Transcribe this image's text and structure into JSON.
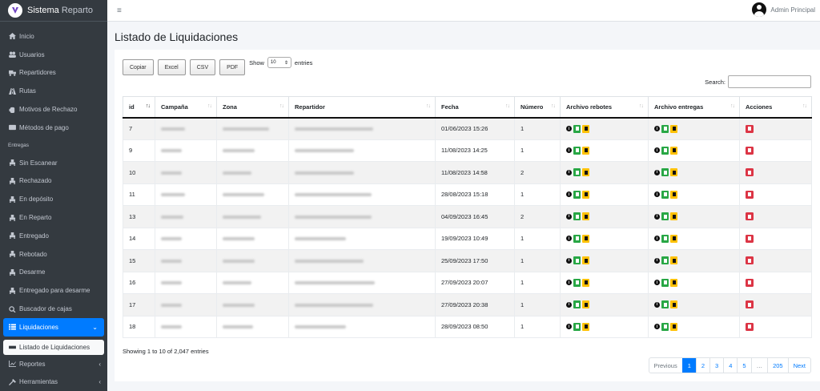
{
  "brand": {
    "name_bold": "Sistema",
    "name_rest": "Reparto"
  },
  "topbar": {
    "menu_icon": "≡",
    "user_name": "Admin Principal"
  },
  "sidebar": {
    "items": [
      {
        "label": "Inicio",
        "icon": "home-icon"
      },
      {
        "label": "Usuarios",
        "icon": "users-icon"
      },
      {
        "label": "Repartidores",
        "icon": "truck-icon"
      },
      {
        "label": "Rutas",
        "icon": "route-icon"
      },
      {
        "label": "Motivos de Rechazo",
        "icon": "hand-icon"
      },
      {
        "label": "Métodos de pago",
        "icon": "card-icon"
      }
    ],
    "header": "Entregas",
    "entregas": [
      {
        "label": "Sin Escanear"
      },
      {
        "label": "Rechazado"
      },
      {
        "label": "En depósito"
      },
      {
        "label": "En Reparto"
      },
      {
        "label": "Entregado"
      },
      {
        "label": "Rebotado"
      },
      {
        "label": "Desarme"
      },
      {
        "label": "Entregado para desarme"
      }
    ],
    "buscador": "Buscador de cajas",
    "liquidaciones": "Liquidaciones",
    "listado": "Listado de Liquidaciones",
    "reportes": "Reportes",
    "herramientas": "Herramientas"
  },
  "page": {
    "title": "Listado de Liquidaciones"
  },
  "toolbar": {
    "copy": "Copiar",
    "excel": "Excel",
    "csv": "CSV",
    "pdf": "PDF",
    "show": "Show",
    "show_value": "10",
    "entries": "entries",
    "search_label": "Search:"
  },
  "table": {
    "headers": [
      "id",
      "Campaña",
      "Zona",
      "Repartidor",
      "Fecha",
      "Número",
      "Archivo rebotes",
      "Archivo entregas",
      "Acciones"
    ],
    "rows": [
      {
        "id": "7",
        "fecha": "01/06/2023 15:26",
        "numero": "1"
      },
      {
        "id": "9",
        "fecha": "11/08/2023 14:25",
        "numero": "1"
      },
      {
        "id": "10",
        "fecha": "11/08/2023 14:58",
        "numero": "2"
      },
      {
        "id": "11",
        "fecha": "28/08/2023 15:18",
        "numero": "1"
      },
      {
        "id": "13",
        "fecha": "04/09/2023 16:45",
        "numero": "2"
      },
      {
        "id": "14",
        "fecha": "19/09/2023 10:49",
        "numero": "1"
      },
      {
        "id": "15",
        "fecha": "25/09/2023 17:50",
        "numero": "1"
      },
      {
        "id": "16",
        "fecha": "27/09/2023 20:07",
        "numero": "1"
      },
      {
        "id": "17",
        "fecha": "27/09/2023 20:38",
        "numero": "1"
      },
      {
        "id": "18",
        "fecha": "28/09/2023 08:50",
        "numero": "1"
      }
    ]
  },
  "footer": {
    "info": "Showing 1 to 10 of 2,047 entries",
    "pager": [
      "Previous",
      "1",
      "2",
      "3",
      "4",
      "5",
      "…",
      "205",
      "Next"
    ]
  },
  "colors": {
    "accent": "#007bff",
    "sidebar": "#343a40",
    "success": "#28a745",
    "warning": "#ffc107",
    "danger": "#dc3545"
  }
}
